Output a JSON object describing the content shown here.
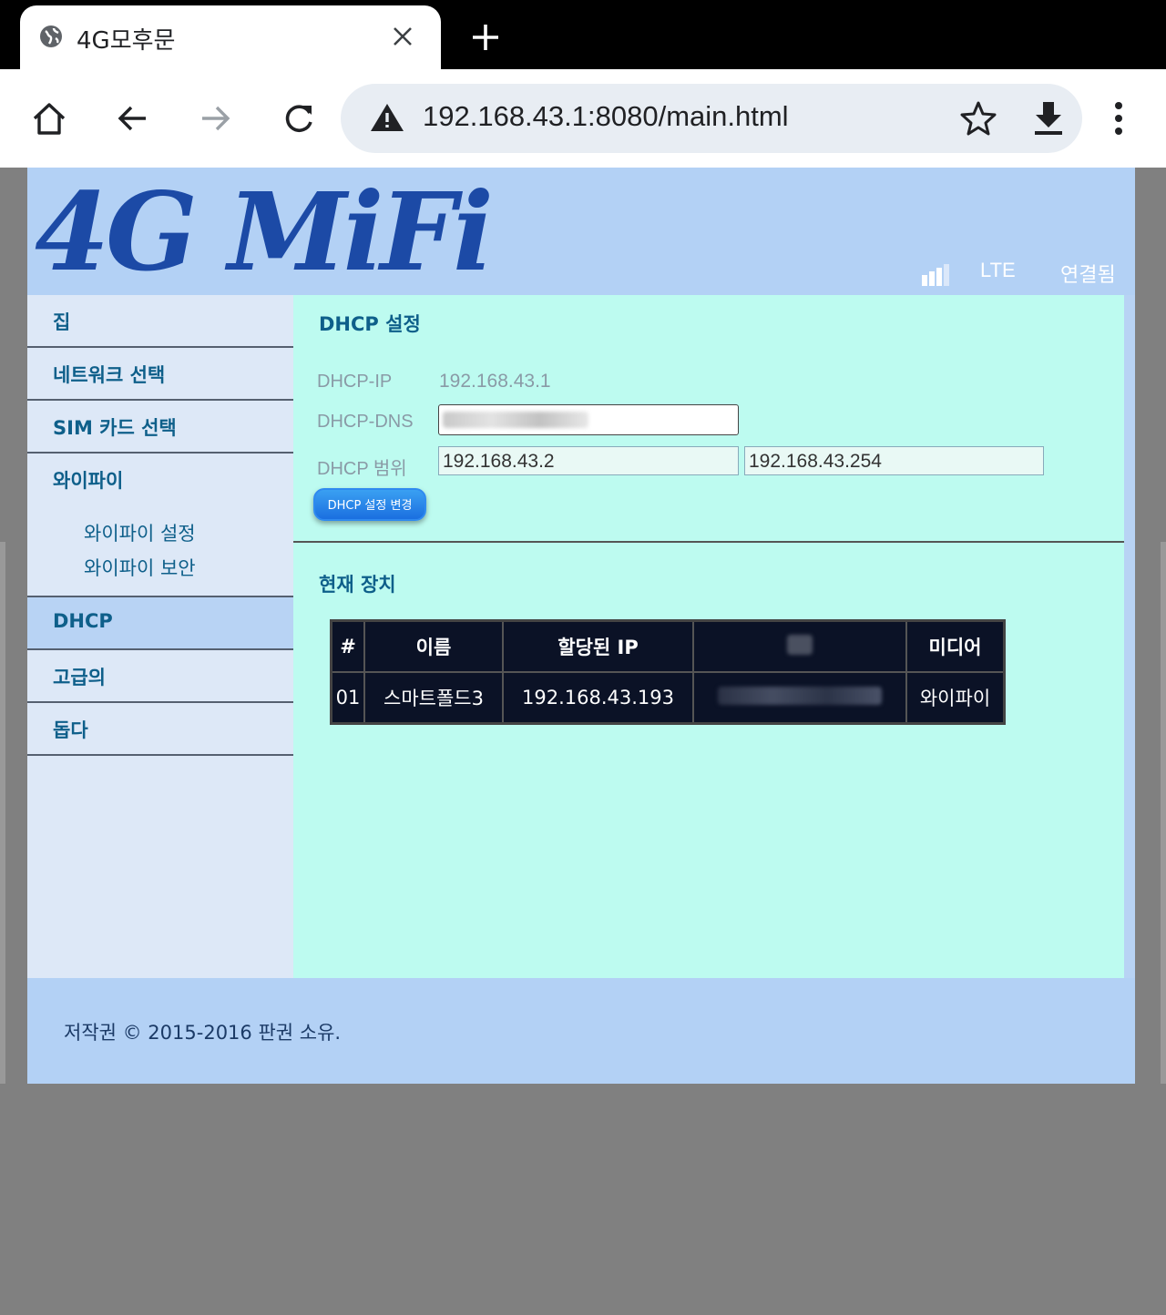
{
  "browser": {
    "tab_title": "4G모후문",
    "url": "192.168.43.1:8080/main.html",
    "icons": [
      "globe-icon",
      "close-icon",
      "plus-icon",
      "home-icon",
      "back-icon",
      "forward-icon",
      "reload-icon",
      "warning-icon",
      "star-icon",
      "download-icon",
      "menu-icon"
    ]
  },
  "header": {
    "logo_text": "4G MiFi",
    "network_type": "LTE",
    "connection_status": "연결됨"
  },
  "sidebar": {
    "items": [
      {
        "label": "집"
      },
      {
        "label": "네트워크 선택"
      },
      {
        "label": "SIM 카드 선택"
      },
      {
        "label": "와이파이"
      },
      {
        "label": "DHCP"
      },
      {
        "label": "고급의"
      },
      {
        "label": "돕다"
      }
    ],
    "wifi_subitems": [
      "와이파이 설정",
      "와이파이 보안"
    ],
    "active": "DHCP"
  },
  "dhcp": {
    "title": "DHCP 설정",
    "ip_label": "DHCP-IP",
    "ip_value": "192.168.43.1",
    "dns_label": "DHCP-DNS",
    "range_label": "DHCP 범위",
    "range_start": "192.168.43.2",
    "range_end": "192.168.43.254",
    "button_label": "DHCP 설정 변경"
  },
  "devices": {
    "title": "현재 장치",
    "columns": [
      "#",
      "이름",
      "할당된 IP",
      "",
      "미디어"
    ],
    "rows": [
      {
        "num": "01",
        "name": "스마트폴드3",
        "ip": "192.168.43.193",
        "mac": "",
        "media": "와이파이"
      }
    ]
  },
  "footer": {
    "copyright": "저작권 © 2015-2016 판권 소유."
  },
  "colors": {
    "header_bg": "#b3d1f5",
    "content_bg": "#bdfbf0",
    "sidebar_bg": "#dde8f7",
    "nav_text": "#0e5f8a",
    "logo": "#1c4aa6",
    "table_bg": "#0b1226"
  }
}
